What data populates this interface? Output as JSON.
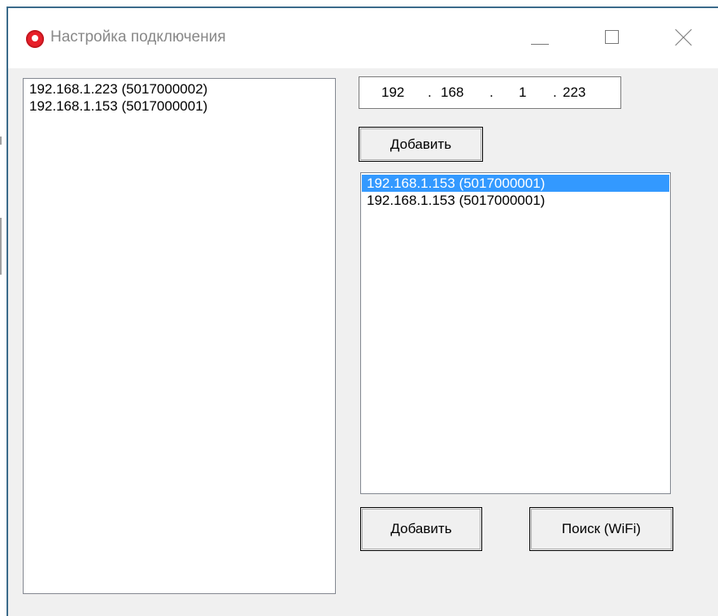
{
  "window": {
    "title": "Настройка подключения"
  },
  "titlebar": {
    "icons": [
      "app-icon",
      "minimize-icon",
      "maximize-icon",
      "close-icon"
    ]
  },
  "left_list": {
    "items": [
      "192.168.1.223 (5017000002)",
      "192.168.1.153 (5017000001)"
    ]
  },
  "ip_address": {
    "octets": [
      "192",
      "168",
      "1",
      "223"
    ],
    "separator": "."
  },
  "buttons": {
    "add_top": "Добавить",
    "add_bottom": "Добавить",
    "search": "Поиск (WiFi)"
  },
  "right_list": {
    "items": [
      "192.168.1.153 (5017000001)",
      "192.168.1.153 (5017000001)"
    ],
    "selected_index": 0,
    "selection_color": "#3399ff"
  }
}
